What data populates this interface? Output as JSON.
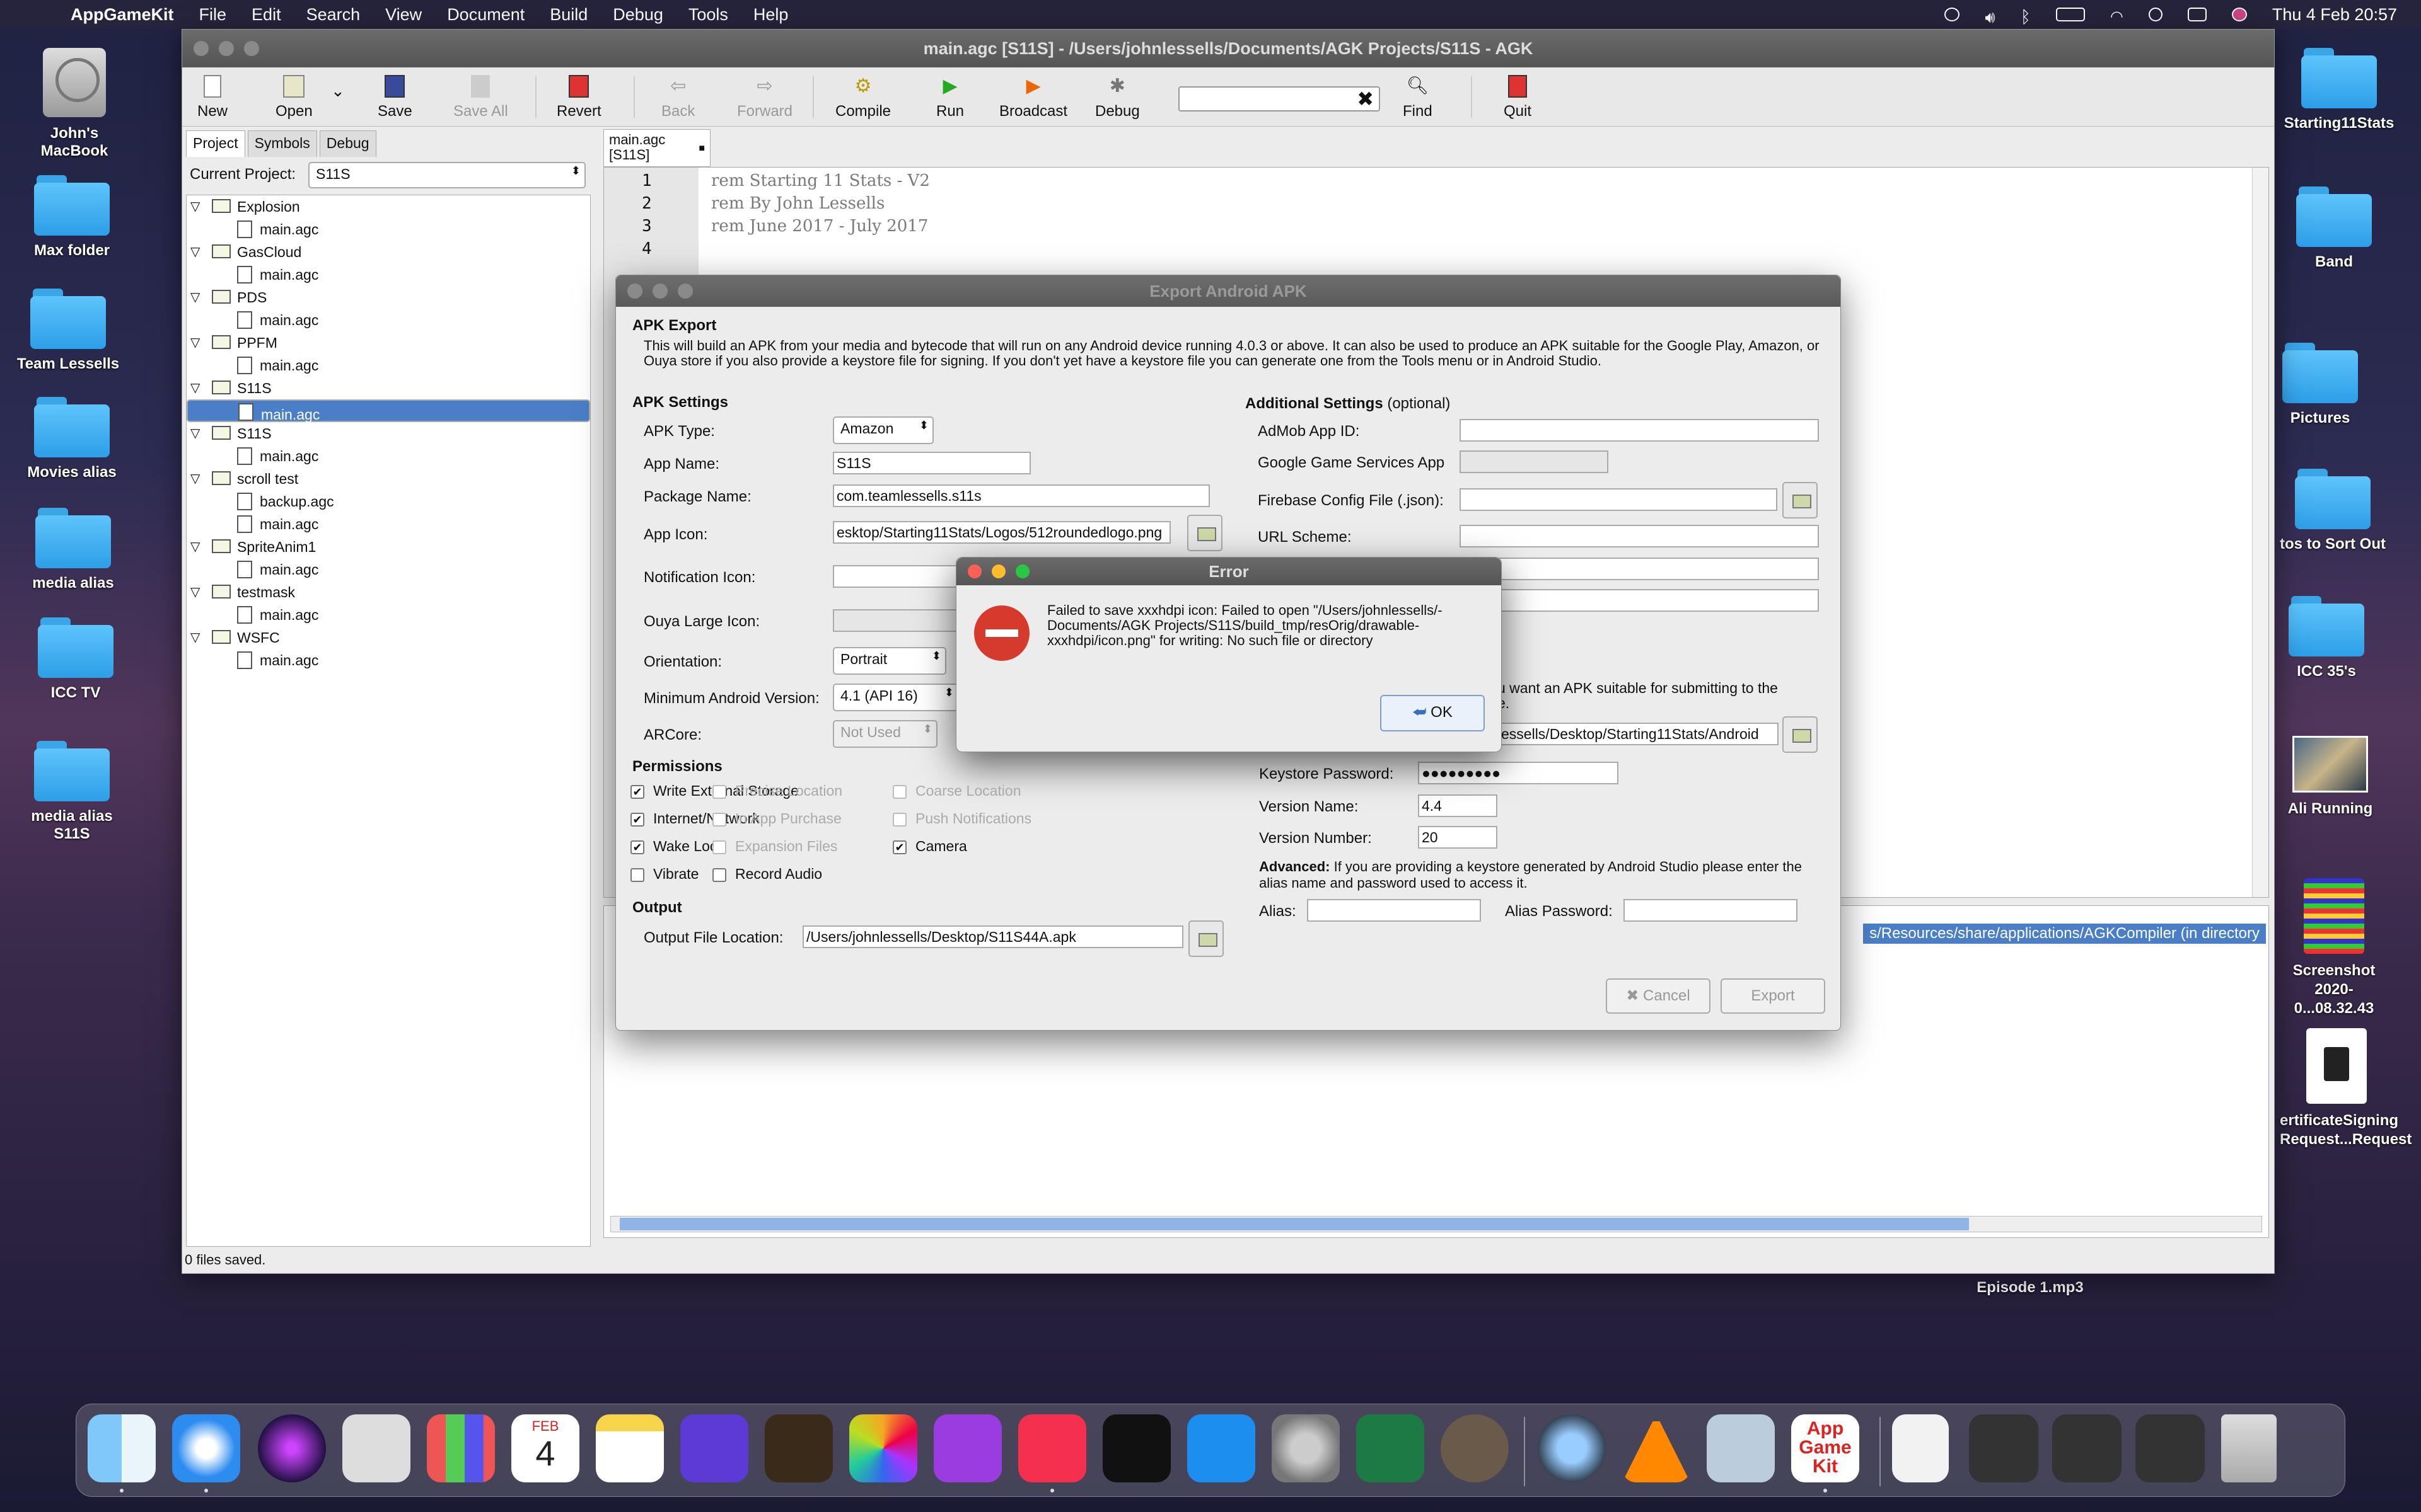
{
  "menubar": {
    "app": "AppGameKit",
    "items": [
      "File",
      "Edit",
      "Search",
      "View",
      "Document",
      "Build",
      "Debug",
      "Tools",
      "Help"
    ],
    "clock": "Thu 4 Feb  20:57"
  },
  "desktop": {
    "left": [
      "John's MacBook",
      "Max folder",
      "Team Lessells",
      "Movies alias",
      "media alias",
      "ICC TV",
      "media alias S11S"
    ],
    "right": [
      "Starting11Stats",
      "Band",
      "Pictures",
      "tos to Sort Out",
      "ICC 35's",
      "Ali Running",
      "Screenshot\n2020-0...08.32.43",
      "ertificateSigning\nRequest...Request"
    ],
    "episode": "Episode 1.mp3"
  },
  "window": {
    "title": "main.agc [S11S] - /Users/johnlessells/Documents/AGK Projects/S11S - AGK",
    "toolbar": {
      "new": "New",
      "open": "Open",
      "save": "Save",
      "save_all": "Save All",
      "revert": "Revert",
      "back": "Back",
      "forward": "Forward",
      "compile": "Compile",
      "run": "Run",
      "broadcast": "Broadcast",
      "debug": "Debug",
      "find": "Find",
      "quit": "Quit"
    },
    "panel_tabs": [
      "Project",
      "Symbols",
      "Debug"
    ],
    "current_project_label": "Current Project:",
    "current_project": "S11S",
    "tree": [
      {
        "t": "f",
        "l": "Explosion"
      },
      {
        "t": "d",
        "l": "main.agc"
      },
      {
        "t": "f",
        "l": "GasCloud"
      },
      {
        "t": "d",
        "l": "main.agc"
      },
      {
        "t": "f",
        "l": "PDS"
      },
      {
        "t": "d",
        "l": "main.agc"
      },
      {
        "t": "f",
        "l": "PPFM"
      },
      {
        "t": "d",
        "l": "main.agc"
      },
      {
        "t": "f",
        "l": "S11S"
      },
      {
        "t": "d",
        "l": "main.agc",
        "sel": true
      },
      {
        "t": "f",
        "l": "S11S"
      },
      {
        "t": "d",
        "l": "main.agc"
      },
      {
        "t": "f",
        "l": "scroll test"
      },
      {
        "t": "d",
        "l": "backup.agc"
      },
      {
        "t": "d",
        "l": "main.agc"
      },
      {
        "t": "f",
        "l": "SpriteAnim1"
      },
      {
        "t": "d",
        "l": "main.agc"
      },
      {
        "t": "f",
        "l": "testmask"
      },
      {
        "t": "d",
        "l": "main.agc"
      },
      {
        "t": "f",
        "l": "WSFC"
      },
      {
        "t": "d",
        "l": "main.agc"
      }
    ],
    "status": "0 files saved.",
    "editor_tab_line1": "main.agc",
    "editor_tab_line2": "[S11S]",
    "code": [
      "rem Starting 11 Stats - V2",
      "rem By John Lessells",
      "rem June 2017 - July 2017"
    ],
    "output_line": "s/Resources/share/applications/AGKCompiler (in directory"
  },
  "apk": {
    "title": "Export Android APK",
    "section": "APK Export",
    "desc": "This will build an APK from your media and bytecode that will run on any Android device running 4.0.3 or above. It can also be used to produce an APK suitable for the Google Play, Amazon, or Ouya store if you also provide a keystore file for signing. If you don't yet have a keystore file you can generate one from the Tools menu or in Android Studio.",
    "settings": "APK Settings",
    "apk_type_l": "APK Type:",
    "apk_type": "Amazon",
    "app_name_l": "App Name:",
    "app_name": "S11S",
    "package_l": "Package Name:",
    "package": "com.teamlessells.s11s",
    "icon_l": "App Icon:",
    "icon": "esktop/Starting11Stats/Logos/512roundedlogo.png",
    "notif_l": "Notification Icon:",
    "ouya_l": "Ouya Large Icon:",
    "orient_l": "Orientation:",
    "orient": "Portrait",
    "minver_l": "Minimum Android Version:",
    "minver": "4.1 (API 16)",
    "arcore_l": "ARCore:",
    "arcore": "Not Used",
    "perm_h": "Permissions",
    "perms": [
      {
        "l": "Write External Storage",
        "c": true,
        "d": false
      },
      {
        "l": "Precise Location",
        "c": false,
        "d": true
      },
      {
        "l": "Coarse Location",
        "c": false,
        "d": true
      },
      {
        "l": "Internet/Network",
        "c": true,
        "d": false
      },
      {
        "l": "In App Purchase",
        "c": false,
        "d": true
      },
      {
        "l": "Push Notifications",
        "c": false,
        "d": true
      },
      {
        "l": "Wake Lock",
        "c": true,
        "d": false
      },
      {
        "l": "Expansion Files",
        "c": false,
        "d": true
      },
      {
        "l": "Camera",
        "c": true,
        "d": false
      },
      {
        "l": "Vibrate",
        "c": false,
        "d": false
      },
      {
        "l": "Record Audio",
        "c": false,
        "d": false
      }
    ],
    "output_h": "Output",
    "out_l": "Output File Location:",
    "out": "/Users/johnlessells/Desktop/S11S44A.apk",
    "add_h": "Additional Settings",
    "add_opt": "(optional)",
    "admob_l": "AdMob App ID:",
    "gg_l": "Google Game Services App",
    "fb_l": "Firebase Config File (.json):",
    "url_l": "URL Scheme:",
    "sign_frag": "u want an APK suitable for submitting to the",
    "sign_frag2": "e.",
    "keystore": "essells/Desktop/Starting11Stats/Android",
    "kspw_l": "Keystore Password:",
    "kspw": "●●●●●●●●●",
    "vname_l": "Version Name:",
    "vname": "4.4",
    "vnum_l": "Version Number:",
    "vnum": "20",
    "adv_b": "Advanced:",
    "adv": " If you are providing a keystore generated by Android Studio please enter the alias name and password used to access it.",
    "alias_l": "Alias:",
    "aliaspw_l": "Alias Password:",
    "cancel": "Cancel",
    "export": "Export"
  },
  "error": {
    "title": "Error",
    "msg": "Failed to save xxxhdpi icon: Failed to open \"/Users/johnlessells/-Documents/AGK Projects/S11S/build_tmp/resOrig/drawable-xxxhdpi/icon.png\" for writing: No such file or directory",
    "ok": "OK"
  },
  "dock": {
    "date_month": "FEB",
    "date_day": "4",
    "agk": "App\nGame\nKit"
  }
}
